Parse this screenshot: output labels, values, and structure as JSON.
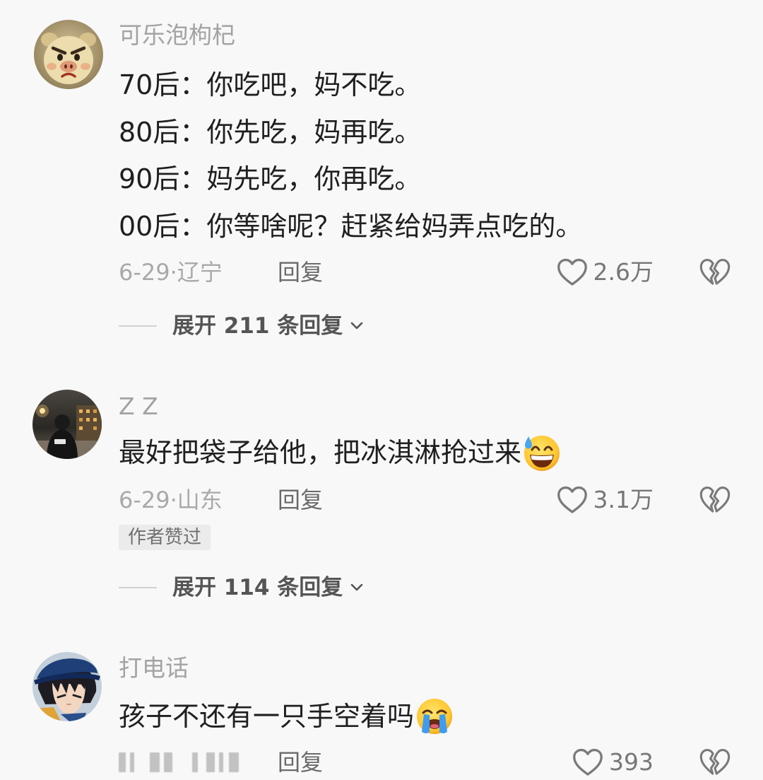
{
  "icons": {
    "like": "heart-outline-icon",
    "dislike": "broken-heart-icon",
    "expand": "chevron-down-icon"
  },
  "comments": [
    {
      "avatar_icon": "cartoon-face-avatar",
      "username": "可乐泡枸杞",
      "content_lines": [
        "70后：你吃吧，妈不吃。",
        "80后：你先吃，妈再吃。",
        "90后：妈先吃，你再吃。",
        "00后：你等啥呢？赶紧给妈弄点吃的。"
      ],
      "date_location": "6-29·辽宁",
      "reply_label": "回复",
      "like_count": "2.6万",
      "expand_replies_label": "展开 211 条回复"
    },
    {
      "avatar_icon": "night-street-photo-avatar",
      "username": "Z Z",
      "content_lines": [
        "最好把袋子给他，把冰淇淋抢过来"
      ],
      "content_emoji": "grinning-sweat-emoji",
      "date_location": "6-29·山东",
      "reply_label": "回复",
      "like_count": "3.1万",
      "author_badge": "作者赞过",
      "expand_replies_label": "展开 114 条回复"
    },
    {
      "avatar_icon": "anime-character-avatar",
      "username": "打电话",
      "content_lines": [
        "孩子不还有一只手空着吗"
      ],
      "content_emoji": "loudly-crying-emoji",
      "reply_label": "回复",
      "like_count": "393"
    }
  ],
  "colors": {
    "background": "#f8f8f8",
    "text_primary": "#1f1f1f",
    "text_secondary": "#a3a3a3",
    "action_text": "#6a6a6a",
    "icon_stroke": "#7a7a7a",
    "badge_background": "#ebebeb"
  }
}
